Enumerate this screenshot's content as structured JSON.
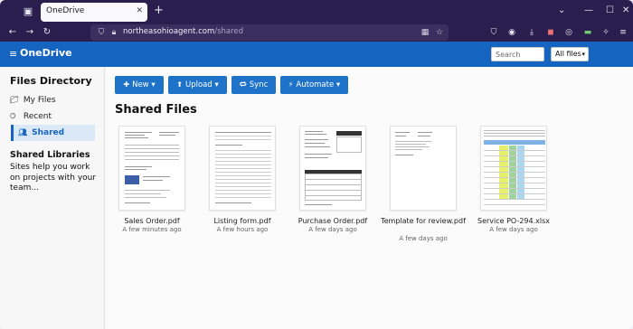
{
  "browser": {
    "tab_title": "OneDrive",
    "url_host": "northeasohioagent.com",
    "url_path": "/shared"
  },
  "app": {
    "title": "OneDrive",
    "search_placeholder": "Search",
    "filter_value": "All files"
  },
  "sidebar": {
    "heading": "Files Directory",
    "items": [
      {
        "label": "My Files",
        "icon": "folder-icon"
      },
      {
        "label": "Recent",
        "icon": "clock-icon"
      },
      {
        "label": "Shared",
        "icon": "people-icon"
      }
    ],
    "shared_libraries_title": "Shared Libraries",
    "shared_libraries_desc": "Sites help you work on projects with your team..."
  },
  "toolbar": {
    "new_label": "New ▾",
    "upload_label": "Upload ▾",
    "sync_label": "Sync",
    "automate_label": "Automate ▾"
  },
  "main": {
    "section_title": "Shared Files",
    "files": [
      {
        "name": "Sales Order.pdf",
        "date": "A few minutes ago"
      },
      {
        "name": "Listing form.pdf",
        "date": "A few hours ago"
      },
      {
        "name": "Purchase Order.pdf",
        "date": "A few days ago"
      },
      {
        "name": "Template for review.pdf",
        "date": "A few days ago"
      },
      {
        "name": "Service PO-294.xlsx",
        "date": "A few days ago"
      }
    ]
  }
}
